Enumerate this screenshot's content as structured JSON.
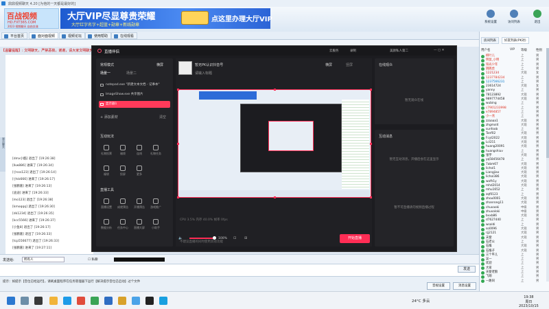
{
  "titlebar": {
    "title": "鼎鼎视频聊天 4.20 [为他的一天都是最好的]"
  },
  "banner": {
    "logo_main": "百战视频",
    "logo_url": "HD.FXT365.COM",
    "logo_sub": "2023 视频聊天 自由交流",
    "ad_title": "大厅VIP尽显尊贵荣耀",
    "ad_sub": "大厅红字名字+超蓝+勋章+新线勋章",
    "ad_cta": "点这里办理大厅VIP"
  },
  "toolbar": [
    {
      "label": "系统设置"
    },
    {
      "label": "访问列表"
    },
    {
      "label": "退出"
    }
  ],
  "tabs": [
    {
      "label": "平台首页"
    },
    {
      "label": "面对面视频"
    },
    {
      "label": "视频论坛"
    },
    {
      "label": "使用帮助"
    },
    {
      "label": "在线观看"
    }
  ],
  "notice": "【温馨提醒】: 文明聊天，严禁恶搞，谢谢，请大家文明聊天...",
  "chat_log": [
    "[dmx小酷] 退出了 [19:26:38]",
    "[lkw886] 进来了 [19:26:34]",
    "[小sss123] 退出了 [19:26:14]",
    "[小kk666] 进来了 [19:26:17]",
    "[张鹏嘉] 进来了 [19:26:13]",
    "[迪迪] 进来了 [19:26:33]",
    "[mo123] 退出了 [19:26:38]",
    "[kmoqqq] 退出了 [19:26:30]",
    "[dk1234] 退出了 [19:26:35]",
    "[kcc5566] 进来了 [19:26:37]",
    "[小鱼8] 退出了 [19:26:17]",
    "[张鹏嘉] 退出了 [19:26:33]",
    "[tcp556677] 退出了 [19:26:33]",
    "[张鹏嘉] 进来了 [19:27:11]"
  ],
  "side_strip": "显示聊天",
  "input_bar": {
    "label": "发送给:",
    "target": "所有人",
    "check": "私聊"
  },
  "send_label": "发送",
  "footer": {
    "tip": "提示：如提示【音位已经运行】，请刷桌面程序在任务管理器下运行【解决提示音位已启动】过个文件",
    "btn1": "音视设置",
    "btn2": "消息设置"
  },
  "studio": {
    "title": "直播伴侣",
    "head_items": [
      "云服务",
      "录制",
      "美颜私人第二"
    ],
    "mode": "常规模式",
    "tab_landscape": "横屏",
    "scene1": "场景一",
    "scene2": "场景二",
    "sources": [
      "notepad.exe \"新建文本文档 - 记事本\"",
      "ImageShow.exe 共享图片",
      "显示器1"
    ],
    "add_source": "添加素材",
    "clear": "清空",
    "interact_title": "互动玩法",
    "interact_items": [
      "礼物投票",
      "福袋",
      "连线",
      "礼物任务",
      "福袋",
      "投屏",
      "更多"
    ],
    "tools_title": "直播工具",
    "tools_items": [
      "直播设置",
      "成就预告",
      "开播预告",
      "游戏推广",
      "数据分析",
      "任务中心",
      "直播大屏",
      "小助手"
    ],
    "live_title": "暂无PK认识抖音号",
    "live_sub": "请输入标题",
    "view_tabs": [
      "横屏",
      "竖屏"
    ],
    "volume": "100%",
    "go_live": "开始直播",
    "status": "CPU 3.5%  内存 40.0%  帧率 0fps",
    "online_title": "在线观众",
    "online_empty": "暂无观众在线",
    "message_title": "互动消息",
    "message_empty1": "暂无互动消息，开播后会在这里显示",
    "message_empty2": "暂不可直播请勿视频直播过程",
    "bottom_hint": "不建议直播的同时使用其他功能"
  },
  "right_panel": {
    "tabs": [
      "房间列表",
      "好友列表(PK对)"
    ],
    "headers": [
      "用户名",
      "VIP",
      "等级",
      "性别"
    ],
    "users": [
      {
        "name": "柳叶儿",
        "lv": "上",
        "rg": "男"
      },
      {
        "name": "明鼠_小明",
        "lv": "上",
        "rg": "男"
      },
      {
        "name": "阳光少年",
        "lv": "上",
        "rg": "男"
      },
      {
        "name": "跳跳虎",
        "lv": "上",
        "rg": "男"
      },
      {
        "name": "1221234",
        "lv": "大观",
        "rg": "女"
      },
      {
        "name": "1237784234",
        "lv": "上",
        "rg": "男"
      },
      {
        "name": "1237566231",
        "lv": "上",
        "rg": "男"
      },
      {
        "name": "23614724",
        "lv": "大观",
        "rg": "女"
      },
      {
        "name": "yanny",
        "lv": "上",
        "rg": "男"
      },
      {
        "name": "78123892",
        "lv": "大观",
        "rg": "男"
      },
      {
        "name": "9897774458",
        "lv": "大观",
        "rg": "男"
      },
      {
        "name": "wubing",
        "lv": "上",
        "rg": "男"
      },
      {
        "name": "c7901233998",
        "lv": "上",
        "rg": "男"
      },
      {
        "name": "e7894857",
        "lv": "上",
        "rg": "男"
      },
      {
        "name": "小一兆",
        "lv": "上",
        "rg": "男"
      },
      {
        "name": "zzaaaa1",
        "lv": "大观",
        "rg": "男"
      },
      {
        "name": "zhgmxl4",
        "lv": "大观",
        "rg": "男"
      },
      {
        "name": "sunfoob",
        "lv": "上",
        "rg": "男"
      },
      {
        "name": "Tanf02",
        "lv": "大观",
        "rg": "男"
      },
      {
        "name": "Fcyt2022",
        "lv": "大观",
        "rg": "男"
      },
      {
        "name": "Lcl211",
        "lv": "大观",
        "rg": "男"
      },
      {
        "name": "huang20091",
        "lv": "大观",
        "rg": "男"
      },
      {
        "name": "huangshiuv",
        "lv": "上",
        "rg": "男"
      },
      {
        "name": "张宇",
        "lv": "大观",
        "rg": "男"
      },
      {
        "name": "yq58456478",
        "lv": "上",
        "rg": "男"
      },
      {
        "name": "7abm67",
        "lv": "大观",
        "rg": "男"
      },
      {
        "name": "lichol1",
        "lv": "大观",
        "rg": "男"
      },
      {
        "name": "Liangjiao",
        "lv": "大观",
        "rg": "男"
      },
      {
        "name": "lichol386",
        "lv": "大观",
        "rg": "男"
      },
      {
        "name": "wofh1y",
        "lv": "大观",
        "rg": "男"
      },
      {
        "name": "mhd2014",
        "lv": "大观",
        "rg": "男"
      },
      {
        "name": "mhu1652",
        "lv": "上",
        "rg": "男"
      },
      {
        "name": "zqf0123",
        "lv": "上",
        "rg": "男"
      },
      {
        "name": "zhou0001",
        "lv": "大观",
        "rg": "男"
      },
      {
        "name": "zhanrong11",
        "lv": "大观",
        "rg": "男"
      },
      {
        "name": "chuxaoki",
        "lv": "中级",
        "rg": "男"
      },
      {
        "name": "zhuxaloki",
        "lv": "中级",
        "rg": "男"
      },
      {
        "name": "bvxb86",
        "lv": "大观",
        "rg": "男"
      },
      {
        "name": "d7627440",
        "lv": "上",
        "rg": "男"
      },
      {
        "name": "wsaldi",
        "lv": "上",
        "rg": "男"
      },
      {
        "name": "so0096",
        "lv": "大观",
        "rg": "男"
      },
      {
        "name": "rjj2121",
        "lv": "大观",
        "rg": "男"
      },
      {
        "name": "天使",
        "lv": "大观",
        "rg": "男"
      },
      {
        "name": "石老公",
        "lv": "上",
        "rg": "男"
      },
      {
        "name": "石猴",
        "lv": "大观",
        "rg": "男"
      },
      {
        "name": "石猴子",
        "lv": "大观",
        "rg": "男"
      },
      {
        "name": "三个平儿",
        "lv": "上",
        "rg": "男"
      },
      {
        "name": "吴一",
        "lv": "上",
        "rg": "男"
      },
      {
        "name": "欢迎",
        "lv": "上",
        "rg": "男"
      },
      {
        "name": "大家",
        "lv": "上",
        "rg": "男"
      },
      {
        "name": "天使老狼",
        "lv": "上",
        "rg": "男"
      },
      {
        "name": "飞翔",
        "lv": "上",
        "rg": "男"
      },
      {
        "name": "一路同",
        "lv": "上",
        "rg": "男"
      }
    ]
  },
  "taskbar": {
    "weather": "24°C  多云",
    "time": "19:38",
    "day": "周日",
    "date": "2023/10/15"
  },
  "colors": {
    "accent": "#ff2d55",
    "studio_bg": "#1c1c20",
    "window_bg": "#dfe8f2"
  }
}
